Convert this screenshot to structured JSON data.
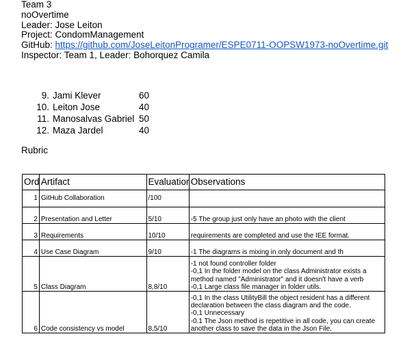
{
  "header": {
    "team": "Team 3",
    "name": "noOvertime",
    "leader": "Leader: Jose Leiton",
    "project": "Project: CondomManagement",
    "github_label": "GitHub: ",
    "github_url": "https://github.com/JoseLeitonProgramer/ESPE0711-OOPSW1973-noOvertime.git",
    "inspector": "Inspector: Team 1, Leader: Bohorquez Camila"
  },
  "members": [
    {
      "num": "9.",
      "name": "Jami Klever",
      "score": "60"
    },
    {
      "num": "10.",
      "name": "Leiton Jose",
      "score": "40"
    },
    {
      "num": "11.",
      "name": "Manosalvas Gabriel",
      "score": "50"
    },
    {
      "num": "12.",
      "name": "Maza Jardel",
      "score": "40"
    }
  ],
  "rubric_title": "Rubric",
  "table": {
    "headers": [
      "Ord",
      "Artifact",
      "Evaluation",
      "Observations"
    ],
    "rows": [
      {
        "ord": "1",
        "artifact": "GitHub Collaboration",
        "evaluation": "/100",
        "observations": [
          ""
        ]
      },
      {
        "ord": "2",
        "artifact": "Presentation and Letter",
        "evaluation": "5/10",
        "observations": [
          " -5 The group just only have an photo with the client"
        ]
      },
      {
        "ord": "3",
        "artifact": "Requirements",
        "evaluation": "10/10",
        "observations": [
          "requirements are completed and use the IEE format."
        ]
      },
      {
        "ord": "4",
        "artifact": "Use Case Diagram",
        "evaluation": "9/10",
        "observations": [
          " -1 The diagrams is mixing in only document and th"
        ]
      },
      {
        "ord": "5",
        "artifact": "Class Diagram",
        "evaluation": "8,8/10",
        "observations": [
          " -1 not found controller folder",
          " -0,1 In the folder model on the class Administrator exists a",
          "method named \"Administrator\" and it doesn't have a verb",
          "-0,1 Large class file manager in folder utils."
        ]
      },
      {
        "ord": "6",
        "artifact": "Code consistency vs model",
        "evaluation": "8,5/10",
        "observations": [
          "-0,1  In the class UtilityBill the object resident has a different",
          "declaration between the class diagram and the code.",
          "-0,1 Unnecessary",
          "-0.1 The Json method is repetitive in all code, you can create",
          "another class to save the data in the Json File."
        ]
      }
    ]
  }
}
